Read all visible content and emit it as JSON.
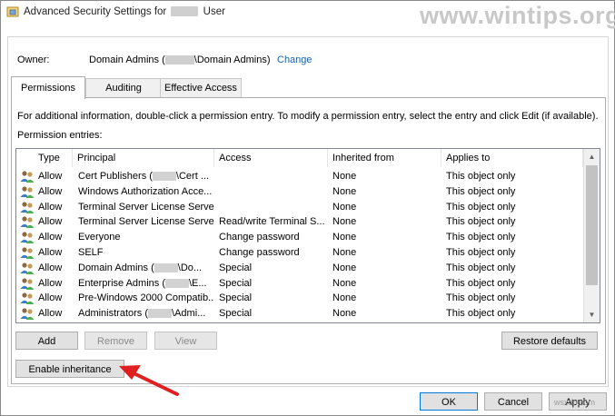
{
  "window": {
    "title_prefix": "Advanced Security Settings for",
    "title_suffix": "User",
    "watermark": "www.wintips.org"
  },
  "owner": {
    "label": "Owner:",
    "value_prefix": "Domain Admins (",
    "value_suffix": "\\Domain Admins)",
    "change_link": "Change"
  },
  "tabs": [
    {
      "label": "Permissions",
      "active": true
    },
    {
      "label": "Auditing",
      "active": false
    },
    {
      "label": "Effective Access",
      "active": false
    }
  ],
  "info_text": "For additional information, double-click a permission entry. To modify a permission entry, select the entry and click Edit (if available).",
  "entries_label": "Permission entries:",
  "columns": [
    "Type",
    "Principal",
    "Access",
    "Inherited from",
    "Applies to"
  ],
  "rows": [
    {
      "type": "Allow",
      "principal_a": "Cert Publishers (",
      "principal_b": "\\Cert ...",
      "redacted": true,
      "access": "",
      "inherited": "None",
      "applies": "This object only"
    },
    {
      "type": "Allow",
      "principal_a": "Windows Authorization Acce...",
      "principal_b": "",
      "redacted": false,
      "access": "",
      "inherited": "None",
      "applies": "This object only"
    },
    {
      "type": "Allow",
      "principal_a": "Terminal Server License Serve...",
      "principal_b": "",
      "redacted": false,
      "access": "",
      "inherited": "None",
      "applies": "This object only"
    },
    {
      "type": "Allow",
      "principal_a": "Terminal Server License Serve...",
      "principal_b": "",
      "redacted": false,
      "access": "Read/write Terminal S...",
      "inherited": "None",
      "applies": "This object only"
    },
    {
      "type": "Allow",
      "principal_a": "Everyone",
      "principal_b": "",
      "redacted": false,
      "access": "Change password",
      "inherited": "None",
      "applies": "This object only"
    },
    {
      "type": "Allow",
      "principal_a": "SELF",
      "principal_b": "",
      "redacted": false,
      "access": "Change password",
      "inherited": "None",
      "applies": "This object only"
    },
    {
      "type": "Allow",
      "principal_a": "Domain Admins (",
      "principal_b": "\\Do...",
      "redacted": true,
      "access": "Special",
      "inherited": "None",
      "applies": "This object only"
    },
    {
      "type": "Allow",
      "principal_a": "Enterprise Admins (",
      "principal_b": "\\E...",
      "redacted": true,
      "access": "Special",
      "inherited": "None",
      "applies": "This object only"
    },
    {
      "type": "Allow",
      "principal_a": "Pre-Windows 2000 Compatib...",
      "principal_b": "",
      "redacted": false,
      "access": "Special",
      "inherited": "None",
      "applies": "This object only"
    },
    {
      "type": "Allow",
      "principal_a": "Administrators (",
      "principal_b": "\\Admi...",
      "redacted": true,
      "access": "Special",
      "inherited": "None",
      "applies": "This object only"
    }
  ],
  "buttons": {
    "add": "Add",
    "remove": "Remove",
    "view": "View",
    "restore": "Restore defaults",
    "enable_inheritance": "Enable inheritance",
    "ok": "OK",
    "cancel": "Cancel",
    "apply": "Apply"
  },
  "footer_watermark": "wsxdn.com",
  "colors": {
    "link": "#1a5fb4",
    "annotation_arrow": "#e02020",
    "default_button_border": "#0078d7"
  },
  "icons": {
    "title": "shield-lock-icon",
    "principal": "user-group-icon",
    "annotation": "red-arrow-icon"
  }
}
